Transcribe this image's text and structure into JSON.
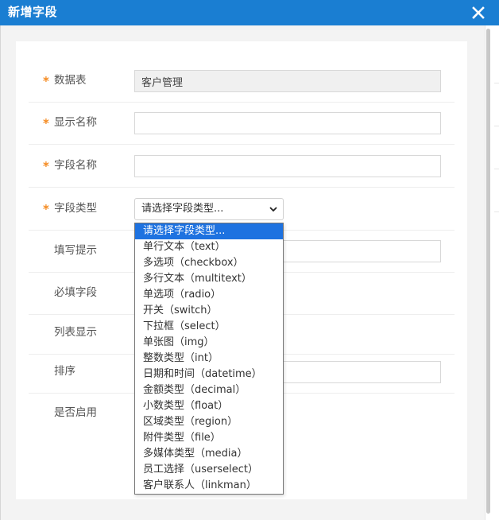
{
  "dialog": {
    "title": "新增字段",
    "close_icon": "close-icon"
  },
  "form": {
    "fields": [
      {
        "label": "数据表",
        "required": "*",
        "value": "客户管理"
      },
      {
        "label": "显示名称",
        "required": "*",
        "value": ""
      },
      {
        "label": "字段名称",
        "required": "*",
        "value": ""
      },
      {
        "label": "字段类型",
        "required": "*",
        "selected": "请选择字段类型..."
      },
      {
        "label": "填写提示",
        "value": ""
      },
      {
        "label": "必填字段"
      },
      {
        "label": "列表显示"
      },
      {
        "label": "排序",
        "value": ""
      },
      {
        "label": "是否启用"
      }
    ]
  },
  "dropdown": {
    "options": [
      "请选择字段类型...",
      "单行文本（text）",
      "多选项（checkbox）",
      "多行文本（multitext）",
      "单选项（radio）",
      "开关（switch）",
      "下拉框（select）",
      "单张图（img）",
      "整数类型（int）",
      "日期和时间（datetime）",
      "金额类型（decimal）",
      "小数类型（float）",
      "区域类型（region）",
      "附件类型（file）",
      "多媒体类型（media）",
      "员工选择（userselect）",
      "客户联系人（linkman）"
    ],
    "highlighted_index": 0
  },
  "colors": {
    "titlebar": "#1a7ed2",
    "required_star": "#f58a1f",
    "option_highlight": "#1e72e0"
  }
}
